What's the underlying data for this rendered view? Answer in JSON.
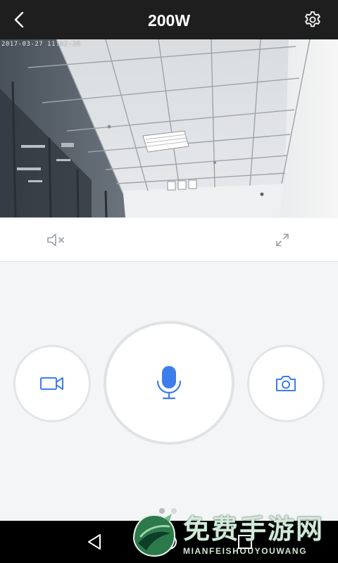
{
  "header": {
    "title": "200W",
    "back_icon": "back-chevron-icon",
    "settings_icon": "gear-icon"
  },
  "video": {
    "timestamp": "2017-03-27  11:02:38"
  },
  "controls": {
    "mute_icon": "speaker-muted-icon",
    "fullscreen_icon": "fullscreen-icon",
    "record_icon": "video-camera-icon",
    "talk_icon": "microphone-icon",
    "snapshot_icon": "camera-icon",
    "accent_color": "#3d7eea"
  },
  "pager": {
    "count": 2,
    "active": 0
  },
  "system_nav": {
    "back_icon": "nav-back-icon",
    "home_icon": "nav-home-icon",
    "recent_icon": "nav-recent-icon"
  },
  "watermark": {
    "chinese": "免费手游网",
    "english": "MIANFEISHOUYOUWANG"
  }
}
